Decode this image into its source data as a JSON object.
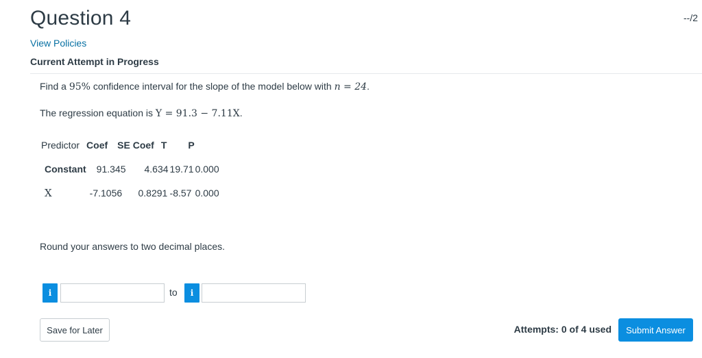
{
  "question": {
    "title": "Question 4",
    "score": "--/2",
    "view_policies": "View Policies",
    "attempt_status": "Current Attempt in Progress"
  },
  "prompt": {
    "line1_before": "Find a ",
    "line1_pct": "95%",
    "line1_mid": " confidence interval for the slope of the model below with ",
    "line1_n": "n = 24",
    "line1_end": ".",
    "line2_before": "The regression equation is ",
    "line2_eq": "Y = 91.3 − 7.11X",
    "line2_end": "."
  },
  "table": {
    "headers": [
      "Predictor",
      "Coef",
      "SE Coef",
      "T",
      "P"
    ],
    "rows": [
      {
        "predictor": "Constant",
        "coef": "91.345",
        "se": "4.634",
        "t": "19.71",
        "p": "0.000"
      },
      {
        "predictor": "X",
        "coef": "-7.1056",
        "se": "0.8291",
        "t": "-8.57",
        "p": "0.000"
      }
    ]
  },
  "instructions": "Round your answers to two decimal places.",
  "answer": {
    "info_glyph": "i",
    "to_label": "to",
    "lower_value": "",
    "upper_value": ""
  },
  "footer": {
    "save_label": "Save for Later",
    "attempts_text": "Attempts: 0 of 4 used",
    "submit_label": "Submit Answer"
  },
  "colors": {
    "link": "#0770a3",
    "primary": "#0b8ee0",
    "text": "#2d3b45"
  }
}
